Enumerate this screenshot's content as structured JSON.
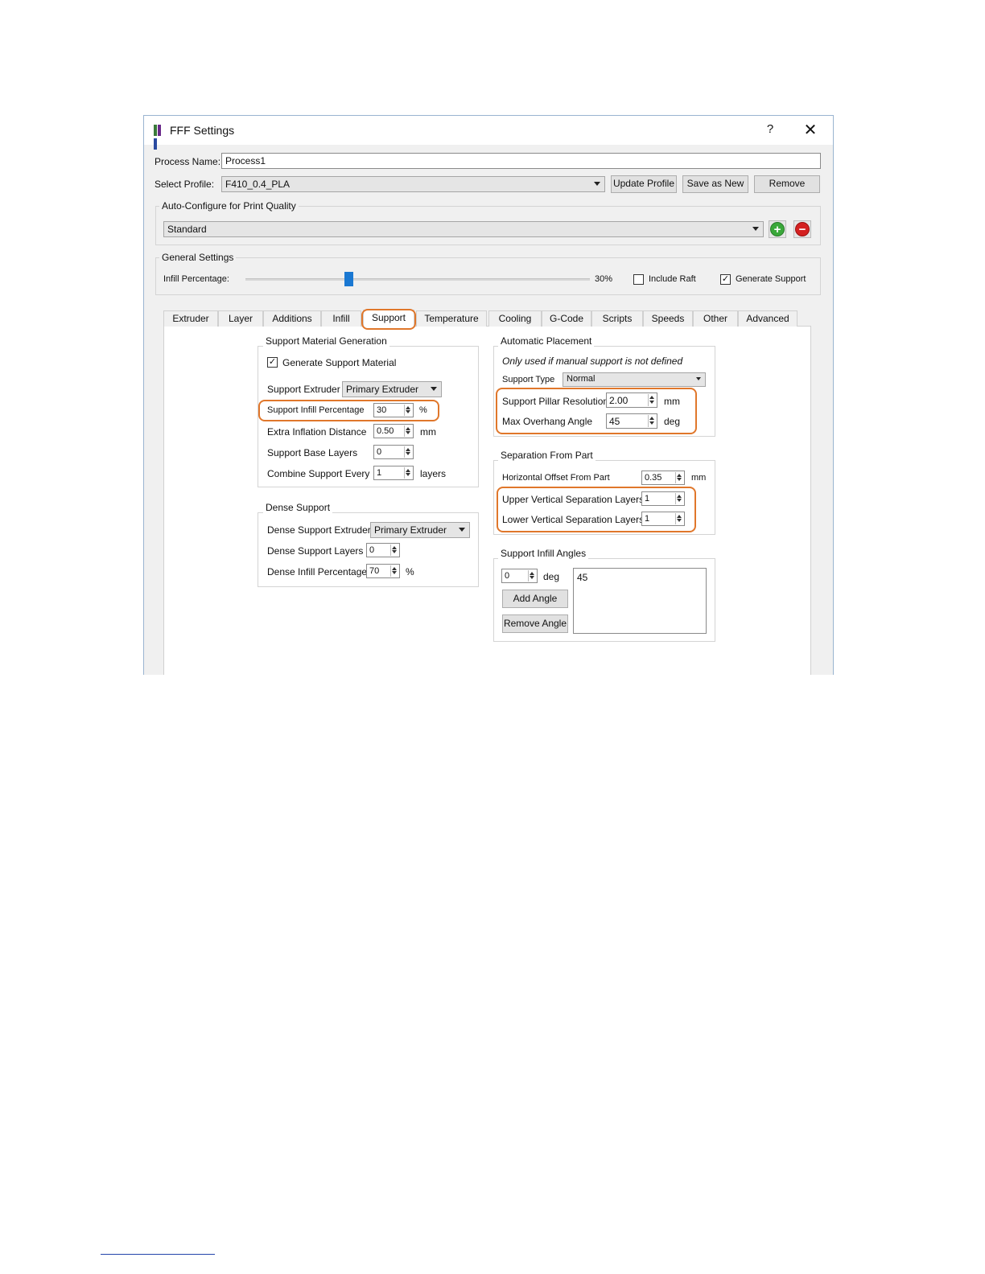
{
  "window": {
    "title": "FFF Settings",
    "help": "?",
    "close": "✕"
  },
  "process_name": {
    "label": "Process Name:",
    "value": "Process1"
  },
  "profile": {
    "label": "Select Profile:",
    "value": "F410_0.4_PLA",
    "update_btn": "Update Profile",
    "save_btn": "Save as New",
    "remove_btn": "Remove"
  },
  "auto_configure": {
    "label": "Auto-Configure for Print Quality",
    "value": "Standard"
  },
  "general": {
    "label": "General Settings",
    "infill_label": "Infill Percentage:",
    "infill_value": "30%",
    "infill_fraction": 0.3,
    "include_raft": "Include Raft",
    "include_raft_checked": false,
    "generate_support": "Generate Support",
    "generate_support_checked": true
  },
  "tabs": [
    "Extruder",
    "Layer",
    "Additions",
    "Infill",
    "Support",
    "Temperature",
    "Cooling",
    "G-Code",
    "Scripts",
    "Speeds",
    "Other",
    "Advanced"
  ],
  "support_material": {
    "label": "Support Material Generation",
    "generate_label": "Generate Support Material",
    "extruder_label": "Support Extruder",
    "extruder_value": "Primary Extruder",
    "infill_label": "Support Infill Percentage",
    "infill_value": "30",
    "infill_unit": "%",
    "inflation_label": "Extra Inflation Distance",
    "inflation_value": "0.50",
    "inflation_unit": "mm",
    "base_label": "Support Base Layers",
    "base_value": "0",
    "combine_label": "Combine Support Every",
    "combine_value": "1",
    "combine_unit": "layers"
  },
  "dense_support": {
    "label": "Dense Support",
    "extruder_label": "Dense Support Extruder",
    "extruder_value": "Primary Extruder",
    "layers_label": "Dense Support Layers",
    "layers_value": "0",
    "infill_label": "Dense Infill Percentage",
    "infill_value": "70",
    "infill_unit": "%"
  },
  "automatic_placement": {
    "label": "Automatic Placement",
    "note": "Only used if manual support is not defined",
    "type_label": "Support Type",
    "type_value": "Normal",
    "pillar_label": "Support Pillar Resolution",
    "pillar_value": "2.00",
    "pillar_unit": "mm",
    "overhang_label": "Max Overhang Angle",
    "overhang_value": "45",
    "overhang_unit": "deg"
  },
  "separation": {
    "label": "Separation From Part",
    "horizontal_label": "Horizontal Offset From Part",
    "horizontal_value": "0.35",
    "horizontal_unit": "mm",
    "upper_label": "Upper Vertical Separation Layers",
    "upper_value": "1",
    "lower_label": "Lower Vertical Separation Layers",
    "lower_value": "1"
  },
  "infill_angles": {
    "label": "Support Infill Angles",
    "angle_value": "0",
    "angle_unit": "deg",
    "add_btn": "Add Angle",
    "remove_btn": "Remove Angle",
    "list": [
      "45"
    ]
  },
  "colors": {
    "highlight": "#e0772b",
    "slider": "#1a78d2",
    "add_icon": "#3aa83a",
    "remove_icon": "#d42020"
  }
}
